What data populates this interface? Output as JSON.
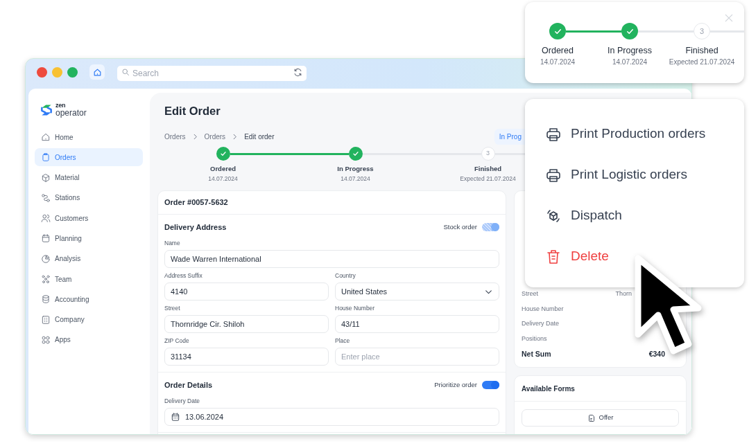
{
  "window": {
    "search": {
      "placeholder": "Search"
    }
  },
  "logo": {
    "brand": "zen",
    "product": "operator"
  },
  "sidebar": {
    "items": [
      {
        "label": "Home",
        "selected": false
      },
      {
        "label": "Orders",
        "selected": true
      },
      {
        "label": "Material",
        "selected": false
      },
      {
        "label": "Stations",
        "selected": false
      },
      {
        "label": "Customers",
        "selected": false
      },
      {
        "label": "Planning",
        "selected": false
      },
      {
        "label": "Analysis",
        "selected": false
      },
      {
        "label": "Team",
        "selected": false
      },
      {
        "label": "Accounting",
        "selected": false
      },
      {
        "label": "Company",
        "selected": false
      },
      {
        "label": "Apps",
        "selected": false
      }
    ]
  },
  "page": {
    "title": "Edit Order",
    "breadcrumb": [
      "Orders",
      "Orders",
      "Edit order"
    ],
    "status_badge": "In Prog"
  },
  "stepper": {
    "steps": [
      {
        "label": "Ordered",
        "date": "14.07.2024",
        "done": true
      },
      {
        "label": "In Progress",
        "date": "14.07.2024",
        "done": true
      },
      {
        "label": "Finished",
        "date": "Expected 21.07.2024",
        "done": false,
        "number": "3"
      }
    ]
  },
  "order_card": {
    "title": "Order #0057-5632",
    "sections": [
      {
        "title": "Delivery Address",
        "toggle": {
          "label": "Stock order",
          "on": true,
          "disabled": true
        },
        "fields": [
          {
            "label": "Name",
            "value": "Wade Warren International",
            "kind": "text",
            "wide": true
          },
          {
            "label": "Address Suffix",
            "value": "4140",
            "kind": "text",
            "wide": false
          },
          {
            "label": "Country",
            "value": "United States",
            "kind": "select",
            "wide": false
          },
          {
            "label": "Street",
            "value": "Thornridge Cir. Shiloh",
            "kind": "text",
            "wide": false
          },
          {
            "label": "House Number",
            "value": "43/11",
            "kind": "text",
            "wide": false
          },
          {
            "label": "ZIP Code",
            "value": "31134",
            "kind": "text",
            "wide": false
          },
          {
            "label": "Place",
            "placeholder": "Enter place",
            "kind": "text",
            "wide": false
          }
        ]
      },
      {
        "title": "Order Details",
        "toggle": {
          "label": "Prioritize order",
          "on": true,
          "disabled": false
        },
        "fields": [
          {
            "label": "Delivery Date",
            "value": "13.06.2024",
            "kind": "date",
            "wide": true
          }
        ]
      }
    ]
  },
  "summary": {
    "rows": [
      {
        "label": "Street",
        "value": "Thorn",
        "total": false
      },
      {
        "label": "House Number",
        "total": false
      },
      {
        "label": "Delivery Date",
        "total": false
      },
      {
        "label": "Positions",
        "total": false
      },
      {
        "label": "Net Sum",
        "value": "€340",
        "total": true
      }
    ]
  },
  "forms_card": {
    "title": "Available Forms",
    "buttons": [
      {
        "label": "Offer"
      }
    ]
  },
  "progress_popover": {
    "steps": [
      {
        "label": "Ordered",
        "date": "14.07.2024",
        "done": true
      },
      {
        "label": "In Progress",
        "date": "14.07.2024",
        "done": true
      },
      {
        "label": "Finished",
        "date": "Expected 21.07.2024",
        "done": false,
        "number": "3"
      }
    ]
  },
  "action_menu": {
    "items": [
      {
        "label": "Print Production orders",
        "kind": "print"
      },
      {
        "label": "Print Logistic orders",
        "kind": "print"
      },
      {
        "label": "Dispatch",
        "kind": "dispatch"
      },
      {
        "label": "Delete",
        "kind": "delete"
      }
    ]
  }
}
